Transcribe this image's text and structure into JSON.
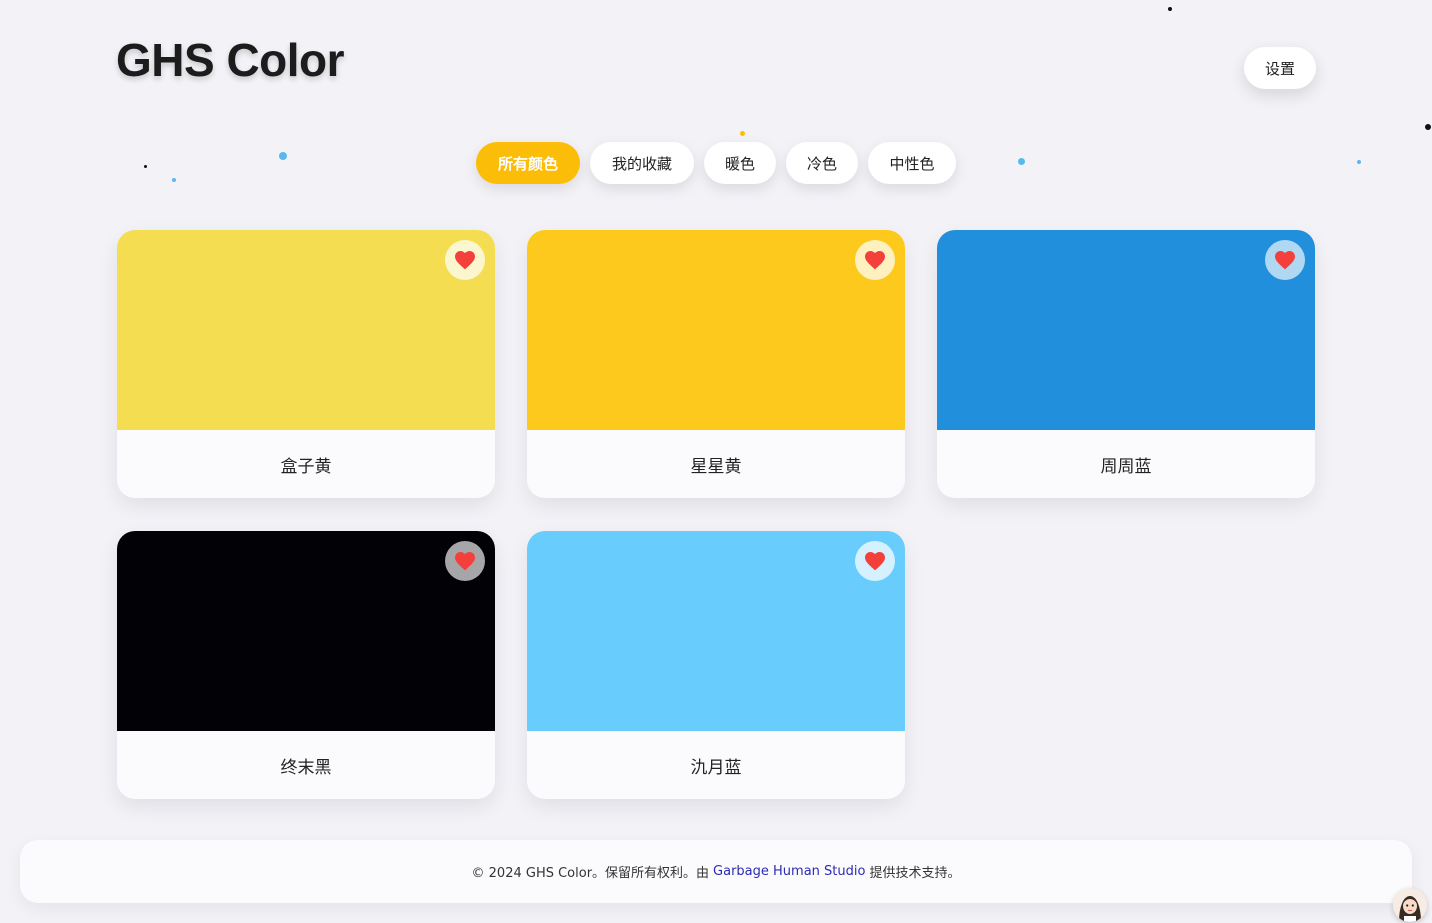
{
  "header": {
    "title": "GHS Color",
    "settings_label": "设置"
  },
  "filters": [
    {
      "label": "所有颜色",
      "active": true
    },
    {
      "label": "我的收藏",
      "active": false
    },
    {
      "label": "暖色",
      "active": false
    },
    {
      "label": "冷色",
      "active": false
    },
    {
      "label": "中性色",
      "active": false
    }
  ],
  "colors": [
    {
      "name": "盒子黄",
      "hex": "#f5dd52",
      "favorited": true
    },
    {
      "name": "星星黄",
      "hex": "#fdc91c",
      "favorited": true
    },
    {
      "name": "周周蓝",
      "hex": "#218fdb",
      "favorited": true
    },
    {
      "name": "终末黑",
      "hex": "#020206",
      "favorited": true
    },
    {
      "name": "氿月蓝",
      "hex": "#68ccfd",
      "favorited": true
    }
  ],
  "footer": {
    "text_before": "© 2024 GHS Color。保留所有权利。由",
    "link_text": "Garbage Human Studio",
    "text_after": "提供技术支持。"
  },
  "theme": {
    "accent": "#fbbd08",
    "heart": "#f4403a",
    "link": "#2b2bb8"
  },
  "icons": {
    "favorite": "heart-icon",
    "avatar": "avatar-icon"
  }
}
